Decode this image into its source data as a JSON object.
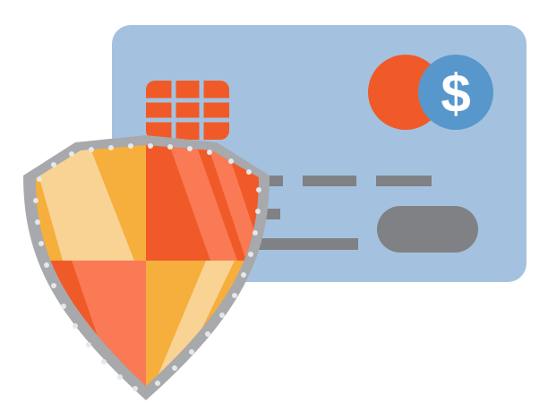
{
  "illustration": {
    "card": {
      "color": "#a4c2df",
      "chip_color": "#f05a28",
      "number_bar_color": "#7f8184",
      "button_color": "#7f8184"
    },
    "logo": {
      "left_circle_color": "#f05a28",
      "right_circle_color": "#5897cb",
      "symbol": "$",
      "symbol_color": "#ffffff"
    },
    "shield": {
      "rim_color": "#a7a9ac",
      "rivet_color": "#e6e7e8",
      "colors": [
        "#f6ae3c",
        "#f05a28",
        "#f97a55",
        "#f8d394"
      ]
    }
  }
}
